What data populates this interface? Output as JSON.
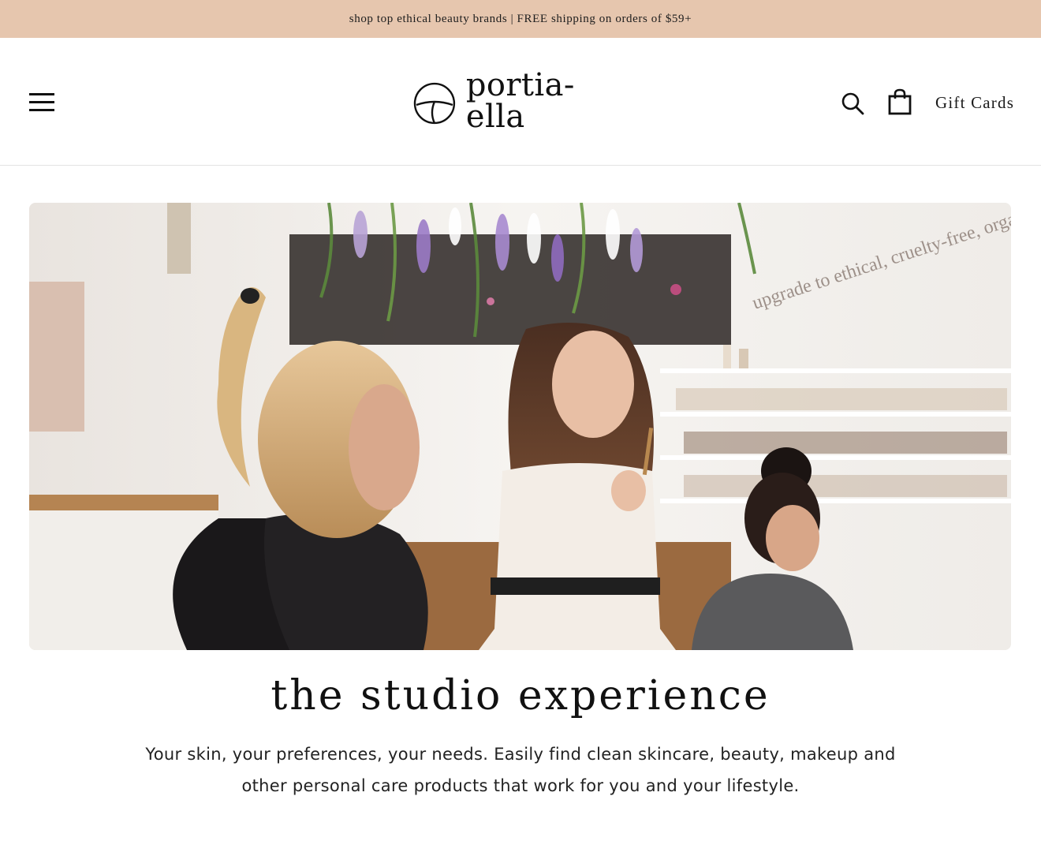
{
  "announcement": {
    "text": "shop top ethical beauty brands | FREE shipping on orders of $59+"
  },
  "header": {
    "menu_icon": "hamburger-menu-icon",
    "logo_text": "portia-ella",
    "search_icon": "search-icon",
    "cart_icon": "shopping-bag-icon",
    "gift_cards_label": "Gift Cards"
  },
  "hero": {
    "image_description_icon": "studio-photo",
    "wall_text": "upgrade to ethical, cruelty-free, organic, vegan s"
  },
  "section": {
    "title": "the studio experience",
    "description": "Your skin, your preferences, your needs. Easily find clean skincare, beauty, makeup and other personal care products that work for you and your lifestyle."
  },
  "colors": {
    "announcement_bg": "#e6c6ae",
    "text": "#1a1a1a",
    "divider": "#e2e2e2"
  }
}
